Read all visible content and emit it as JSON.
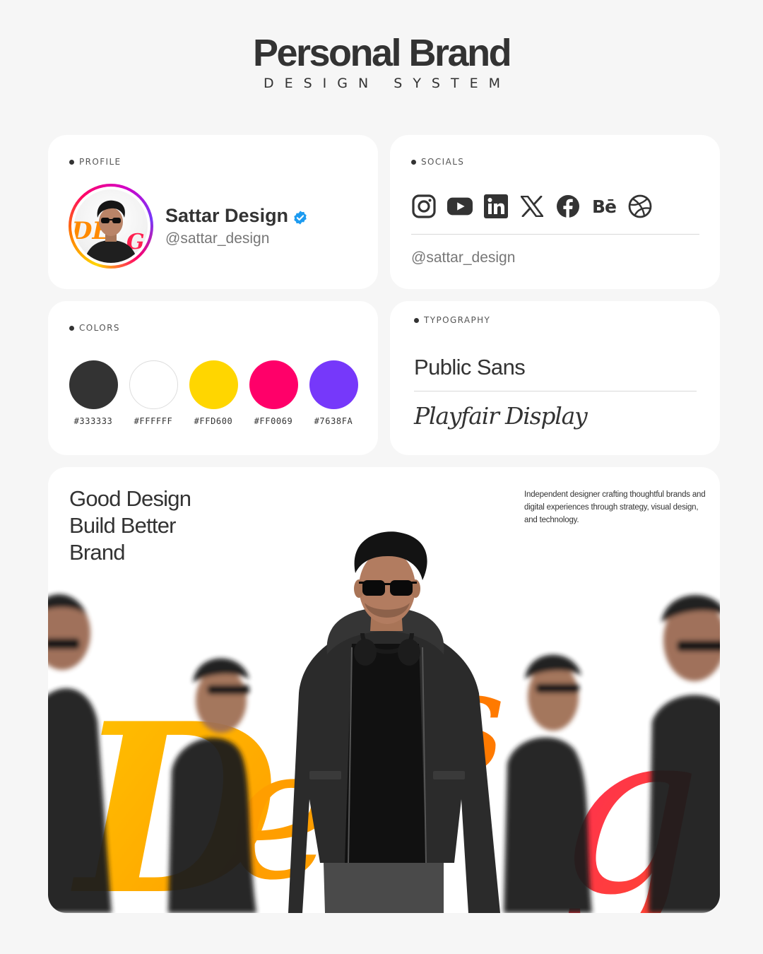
{
  "header": {
    "title": "Personal Brand",
    "subtitle": "DESIGN SYSTEM"
  },
  "profile": {
    "label": "PROFILE",
    "name": "Sattar Design",
    "handle": "@sattar_design",
    "verified": true,
    "avatar_icon": "person-photo-avatar"
  },
  "socials": {
    "label": "SOCIALS",
    "icons": [
      "instagram-icon",
      "youtube-icon",
      "linkedin-icon",
      "x-icon",
      "facebook-icon",
      "behance-icon",
      "dribbble-icon"
    ],
    "behance_text": "Bē",
    "handle": "@sattar_design"
  },
  "colors": {
    "label": "COLORS",
    "swatches": [
      {
        "hex": "#333333",
        "color": "#333333"
      },
      {
        "hex": "#FFFFFF",
        "color": "#FFFFFF"
      },
      {
        "hex": "#FFD600",
        "color": "#FFD600"
      },
      {
        "hex": "#FF0069",
        "color": "#FF0069"
      },
      {
        "hex": "#7638FA",
        "color": "#7638FA"
      }
    ]
  },
  "typography": {
    "label": "TYPOGRAPHY",
    "sans": "Public Sans",
    "serif": "Playfair Display"
  },
  "hero": {
    "tagline": [
      "Good Design",
      "Build Better",
      "Brand"
    ],
    "bio": "Independent designer crafting thoughtful brands and digital experiences through strategy, visual design, and technology.",
    "background_word_colors": [
      "#FFB000",
      "#FF7A00",
      "#FF2050"
    ]
  }
}
